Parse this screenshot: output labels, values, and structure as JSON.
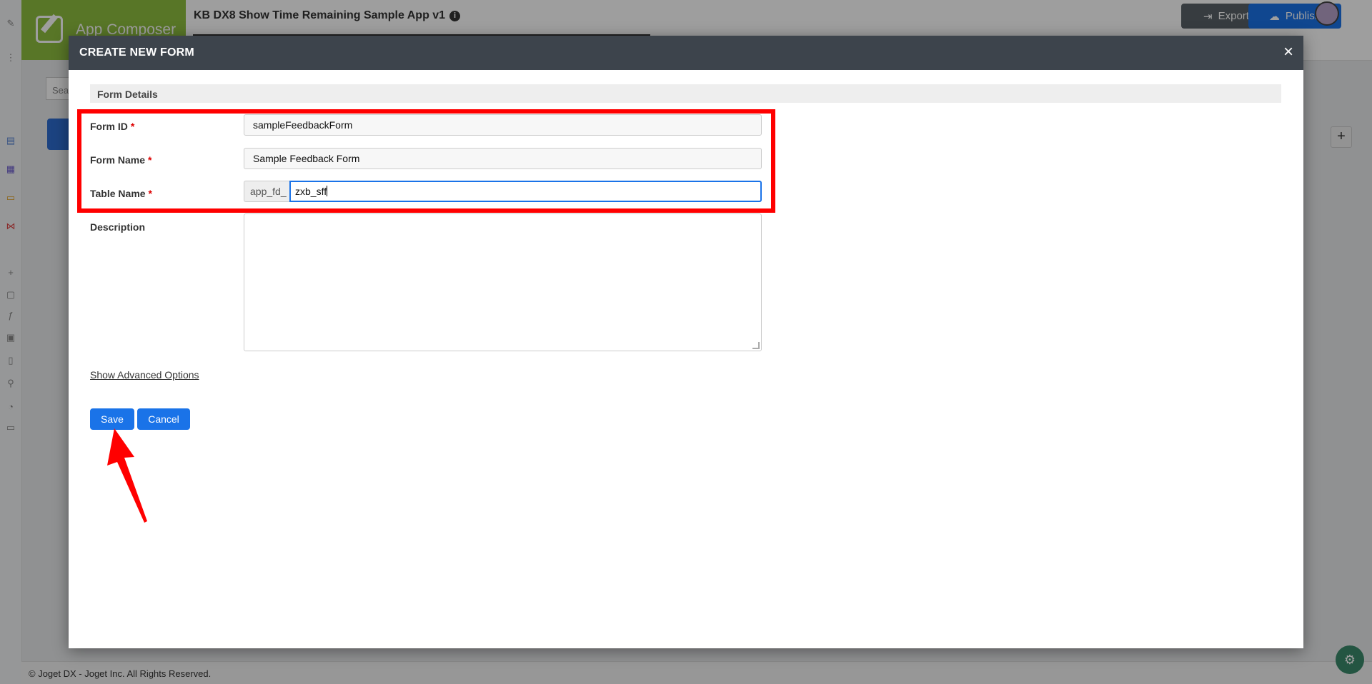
{
  "brand": {
    "title": "App Composer"
  },
  "header": {
    "app_title": "KB DX8 Show Time Remaining Sample App v1",
    "info_icon": "i",
    "export_label": "Export",
    "publish_label": "Publish"
  },
  "background": {
    "search_placeholder": "Sea",
    "plus_label": "+"
  },
  "modal": {
    "title": "CREATE NEW FORM",
    "close_label": "×",
    "section_title": "Form Details",
    "form_id": {
      "label": "Form ID",
      "required": "*",
      "value": "sampleFeedbackForm"
    },
    "form_name": {
      "label": "Form Name",
      "required": "*",
      "value": "Sample Feedback Form"
    },
    "table_name": {
      "label": "Table Name",
      "required": "*",
      "prefix": "app_fd_",
      "value": "zxb_sff"
    },
    "description": {
      "label": "Description",
      "value": ""
    },
    "advanced_link": "Show Advanced Options",
    "save_label": "Save",
    "cancel_label": "Cancel"
  },
  "footer": {
    "copyright": "© Joget DX - Joget Inc. All Rights Reserved."
  },
  "colors": {
    "highlight": "#ff0000",
    "primary": "#1a73e8",
    "modal_header": "#3d444c"
  }
}
